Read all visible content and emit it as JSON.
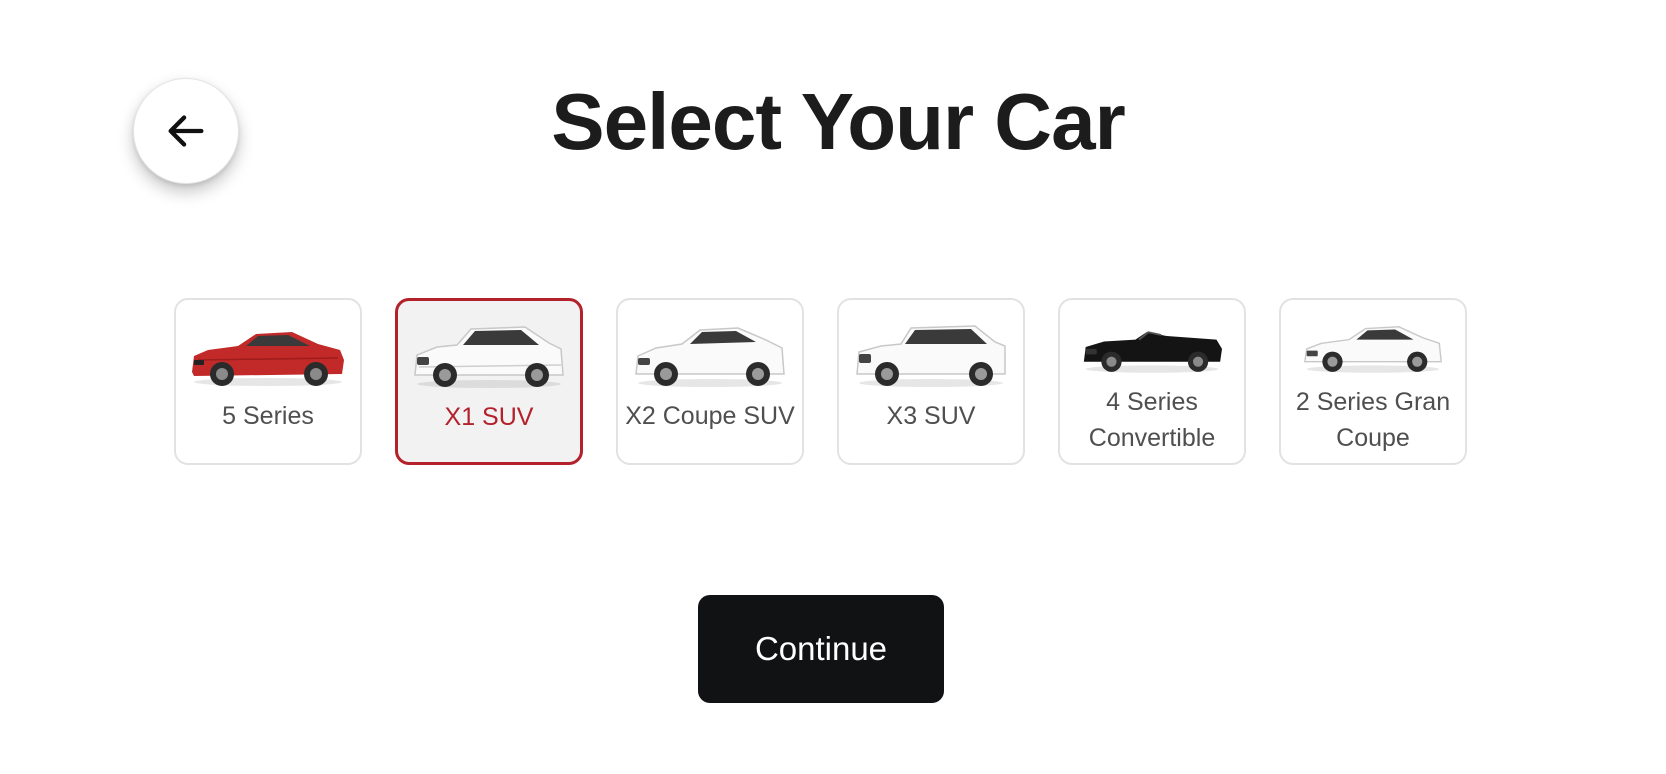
{
  "header": {
    "title": "Select Your Car",
    "back_icon": "arrow-left-icon"
  },
  "cars": [
    {
      "label": "5 Series",
      "color": "#c22a2a",
      "selected": false
    },
    {
      "label": "X1 SUV",
      "color": "#ffffff",
      "selected": true
    },
    {
      "label": "X2 Coupe SUV",
      "color": "#ffffff",
      "selected": false
    },
    {
      "label": "X3 SUV",
      "color": "#ffffff",
      "selected": false
    },
    {
      "label": "4 Series Convertible",
      "color": "#141414",
      "selected": false
    },
    {
      "label": "2 Series Gran Coupe",
      "color": "#ffffff",
      "selected": false
    }
  ],
  "colors": {
    "accent": "#b3212a",
    "button_bg": "#111214",
    "card_border": "#e2e2e2"
  },
  "actions": {
    "continue_label": "Continue"
  }
}
